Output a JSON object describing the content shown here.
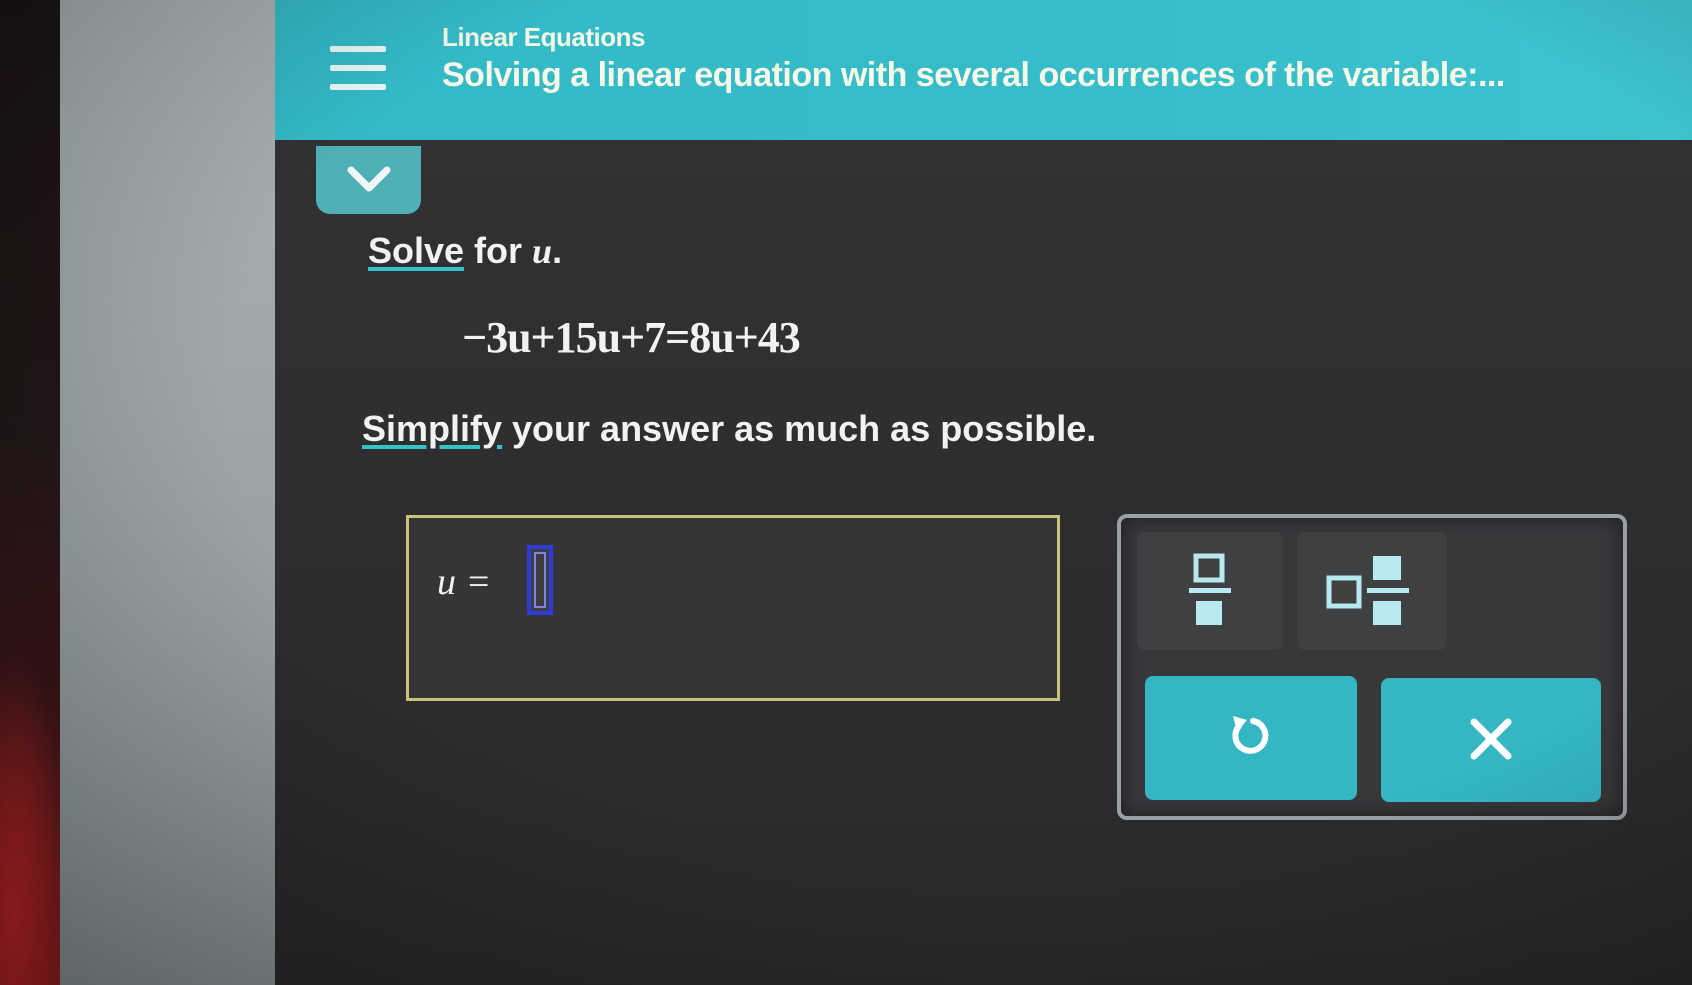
{
  "header": {
    "topic": "Linear Equations",
    "subtitle": "Solving a linear equation with several occurrences of the variable:..."
  },
  "icons": {
    "menu": "hamburger-menu-icon",
    "collapse": "chevron-down-icon",
    "fraction": "fraction-icon",
    "mixed_number": "mixed-number-icon",
    "undo": "undo-icon",
    "clear": "close-icon"
  },
  "problem": {
    "solve_link": "Solve",
    "solve_rest": " for ",
    "variable": "u",
    "period": ".",
    "equation": "−3u+15u+7=8u+43",
    "simplify_link": "Simplify",
    "simplify_rest": " your answer as much as possible."
  },
  "answer": {
    "label": "u =",
    "value": ""
  },
  "colors": {
    "accent": "#34b9c6",
    "background": "#2f2f31",
    "answer_border": "#c8c27a",
    "cursor_blue": "#2f3bd8"
  }
}
